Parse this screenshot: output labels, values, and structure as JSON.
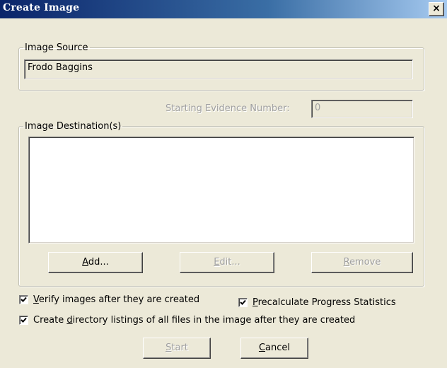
{
  "window": {
    "title": "Create Image",
    "close_glyph": "×"
  },
  "image_source": {
    "legend": "Image Source",
    "value": "Frodo Baggins"
  },
  "evidence": {
    "label": "Starting Evidence Number:",
    "value": "0"
  },
  "destinations": {
    "legend": "Image Destination(s)",
    "items": [],
    "buttons": {
      "add": {
        "pre": "",
        "accel": "A",
        "post": "dd..."
      },
      "edit": {
        "pre": "",
        "accel": "E",
        "post": "dit..."
      },
      "remove": {
        "pre": "",
        "accel": "R",
        "post": "emove"
      }
    }
  },
  "options": {
    "verify": {
      "checked": true,
      "pre": "",
      "accel": "V",
      "post": "erify images after they are created"
    },
    "precalculate": {
      "checked": true,
      "pre": "",
      "accel": "P",
      "post": "recalculate Progress Statistics"
    },
    "directory": {
      "checked": true,
      "pre": "Create ",
      "accel": "d",
      "post": "irectory listings of all files in the image after they are created"
    }
  },
  "footer": {
    "start": {
      "pre": "",
      "accel": "S",
      "post": "tart"
    },
    "cancel": {
      "pre": "",
      "accel": "C",
      "post": "ancel"
    }
  },
  "colors": {
    "titlebar_start": "#0a246a",
    "dialog_bg": "#ece9d8",
    "disabled_text": "#a0a0a0"
  }
}
